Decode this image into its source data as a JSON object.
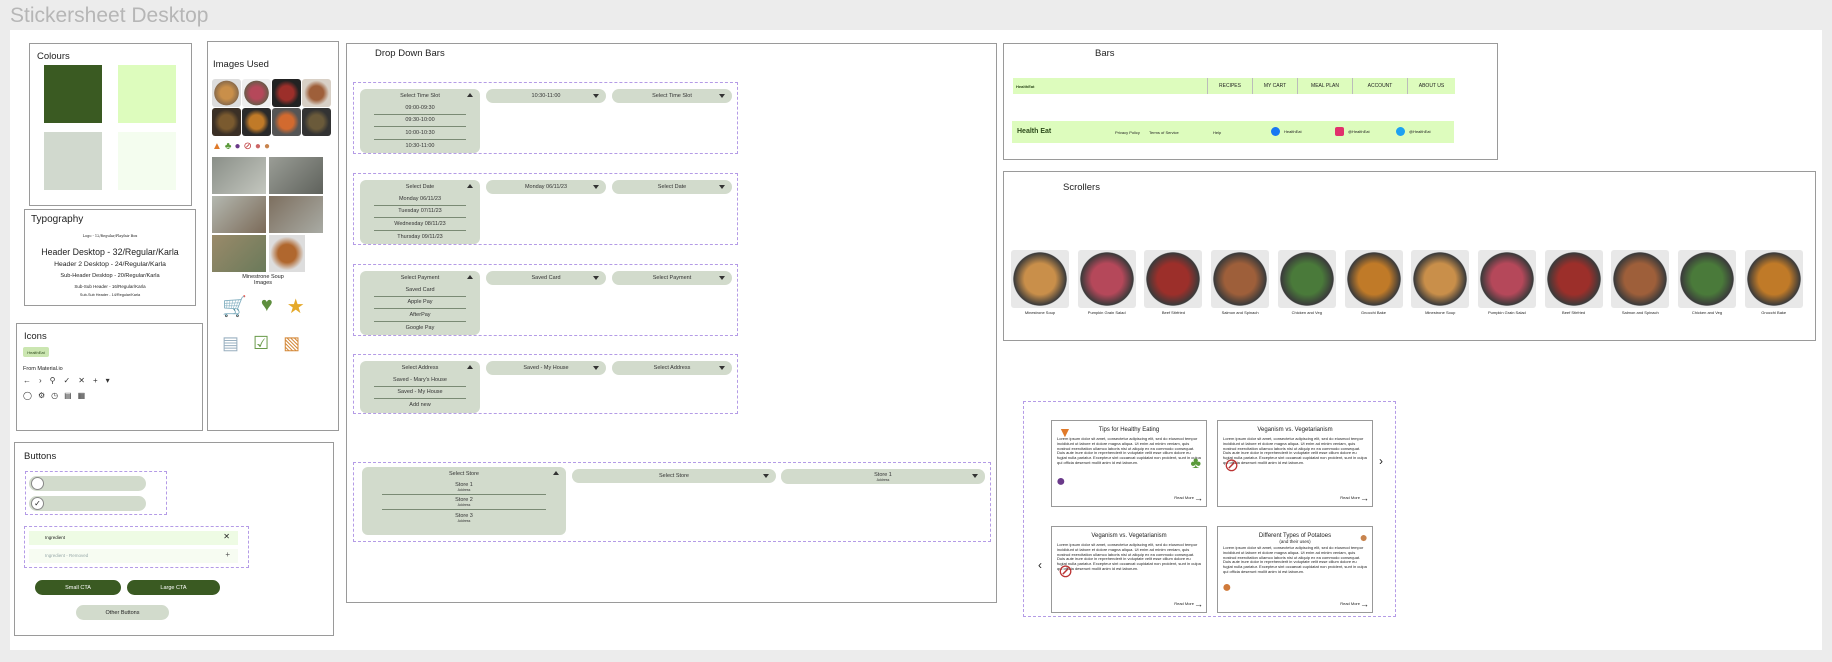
{
  "page_title": "Stickersheet Desktop",
  "colours": {
    "title": "Colours",
    "swatches": [
      "#3a5a22",
      "#ddfcbd",
      "#d1d9ce",
      "#f4fdef"
    ]
  },
  "typography": {
    "title": "Typography",
    "lines": [
      "Logo - 12/Regular/Playfair Box",
      "Header Desktop - 32/Regular/Karla",
      "Header 2 Desktop - 24/Regular/Karla",
      "Sub-Header Desktop - 20/Regular/Karla",
      "Sub-Sub Header - 16/Regular/Karla",
      "Sub-Sub Header - 14/Regular/Karla"
    ]
  },
  "icons_panel": {
    "title": "Icons",
    "from_label": "From Material.io",
    "logo_text": "HealthEat",
    "row1": [
      "arrow-back-icon",
      "chevron-right-icon",
      "search-icon",
      "check-icon",
      "close-icon",
      "plus-icon",
      "caret-down-icon"
    ],
    "row2": [
      "apple-icon",
      "settings-icon",
      "clock-icon",
      "basket-icon",
      "calendar-icon"
    ]
  },
  "buttons": {
    "title": "Buttons",
    "ingredient_label": "Ingredient",
    "ingredient_label_2": "Ingredient - Removed",
    "remove_label": "Remove",
    "small_cta": "Small CTA",
    "large_cta": "Large CTA",
    "other": "Other Buttons"
  },
  "images_used": {
    "title": "Images Used",
    "caption": "Minestrone Soup Images"
  },
  "dropdowns": {
    "title": "Drop Down Bars",
    "rows": [
      {
        "open_label": "Select Time Slot",
        "items": [
          "09:00-09:30",
          "09:30-10:00",
          "10:00-10:30",
          "10:30-11:00"
        ],
        "selected": "10:30-11:00",
        "closed": "Select Time Slot"
      },
      {
        "open_label": "Select Date",
        "items": [
          "Monday 06/11/23",
          "Tuesday 07/11/23",
          "Wednesday 08/11/23",
          "Thursday 09/11/23"
        ],
        "selected": "Monday 06/11/23",
        "closed": "Select Date"
      },
      {
        "open_label": "Select Payment",
        "items": [
          "Saved Card",
          "Apple Pay",
          "AfterPay",
          "Google Pay"
        ],
        "selected": "Saved Card",
        "closed": "Select Payment"
      },
      {
        "open_label": "Select Address",
        "items": [
          "Saved - Mary's House",
          "Saved - My House",
          "Add new"
        ],
        "selected": "Saved - My House",
        "closed": "Select Address"
      }
    ],
    "store": {
      "open_label": "Select Store",
      "items": [
        {
          "name": "Store 1",
          "sub": "Address"
        },
        {
          "name": "Store 2",
          "sub": "Address"
        },
        {
          "name": "Store 3",
          "sub": "Address"
        }
      ],
      "closed": "Select Store",
      "selected": "Store 1",
      "selected_sub": "Address"
    }
  },
  "bars": {
    "title": "Bars",
    "logo_text": "HealthEat",
    "nav": [
      "RECIPES",
      "MY CART",
      "MEAL PLAN",
      "ACCOUNT",
      "ABOUT US"
    ],
    "footer_logo": "Health Eat",
    "footer_links": [
      "Privacy Policy",
      "Terms of Service",
      "Help"
    ],
    "socials": [
      {
        "icon": "facebook-icon",
        "label": "HealthEat",
        "color": "#1877f2"
      },
      {
        "icon": "instagram-icon",
        "label": "@HealthEat",
        "color": "#e1306c"
      },
      {
        "icon": "twitter-icon",
        "label": "@HealthEat",
        "color": "#1da1f2"
      }
    ]
  },
  "scrollers": {
    "title": "Scrollers",
    "items": [
      "Minestrone Soup",
      "Pumpkin Grain Salad",
      "Beef Stirfried",
      "Salmon and Spinach",
      "Chicken and Veg",
      "Gnocchi Bake",
      "Minestrone Soup",
      "Pumpkin Grain Salad",
      "Beef Stirfried",
      "Salmon and Spinach",
      "Chicken and Veg",
      "Gnocchi Bake"
    ]
  },
  "blog_cards": [
    {
      "title": "Tips for Healthy Eating",
      "subtitle": "",
      "read_more": "Read More"
    },
    {
      "title": "Veganism vs. Vegetarianism",
      "subtitle": "",
      "read_more": "Read More"
    },
    {
      "title": "Veganism vs. Vegetarianism",
      "subtitle": "",
      "read_more": "Read More"
    },
    {
      "title": "Different Types of Potatoes",
      "subtitle": "(and their uses)",
      "read_more": "Read More"
    }
  ],
  "lorem": "Lorem ipsum dolor sit amet, consectetur adipiscing elit, sed do eiusmod tempor incididunt ut labore et dolore magna aliqua. Ut enim ad minim veniam, quis nostrud exercitation ullamco laboris nisi ut aliquip ex ea commodo consequat. Duis aute irure dolor in reprehenderit in voluptate velit esse cillum dolore eu fugiat nulla pariatur. Excepteur sint occaecat cupidatat non proident, sunt in culpa qui officia deserunt mollit anim id est laborum.",
  "colors": {
    "green_dark": "#3a5a22",
    "green_light": "#ddfcbd",
    "sage": "#d1d9ce",
    "pale": "#f4fdef",
    "dash": "#b49be6"
  }
}
